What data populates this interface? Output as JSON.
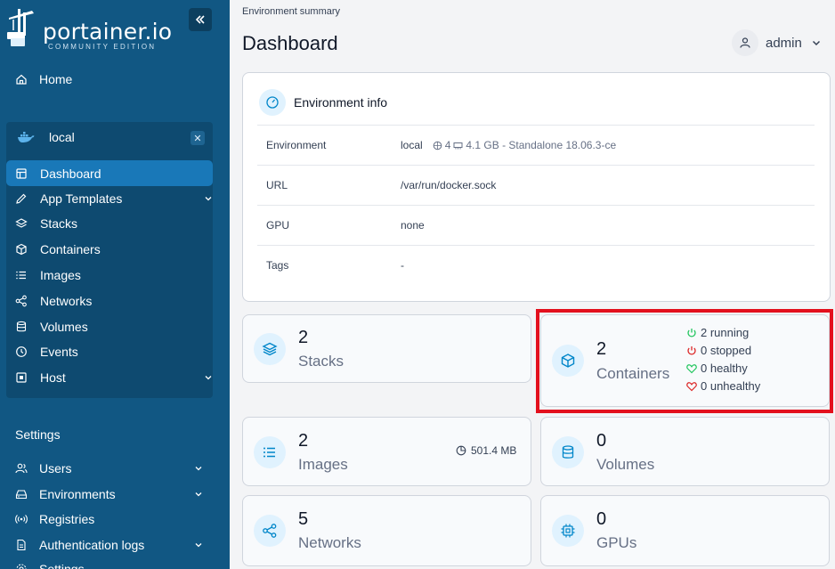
{
  "sidebar": {
    "logo_text": "portainer.io",
    "logo_sub": "COMMUNITY EDITION",
    "home_label": "Home",
    "environment": {
      "name": "local",
      "items": [
        {
          "label": "Dashboard",
          "icon": "dashboard-icon"
        },
        {
          "label": "App Templates",
          "icon": "edit-icon"
        },
        {
          "label": "Stacks",
          "icon": "layers-icon"
        },
        {
          "label": "Containers",
          "icon": "box-icon"
        },
        {
          "label": "Images",
          "icon": "list-icon"
        },
        {
          "label": "Networks",
          "icon": "share-icon"
        },
        {
          "label": "Volumes",
          "icon": "database-icon"
        },
        {
          "label": "Events",
          "icon": "clock-icon"
        },
        {
          "label": "Host",
          "icon": "cpu-icon"
        }
      ]
    },
    "settings_title": "Settings",
    "settings_items": [
      {
        "label": "Users"
      },
      {
        "label": "Environments"
      },
      {
        "label": "Registries"
      },
      {
        "label": "Authentication logs"
      },
      {
        "label": "Settings"
      }
    ]
  },
  "header": {
    "breadcrumb": "Environment summary",
    "title": "Dashboard",
    "user": "admin"
  },
  "env_info": {
    "title": "Environment info",
    "rows": [
      {
        "key": "Environment",
        "value": "local",
        "cpu": "4",
        "mem": "4.1 GB - Standalone 18.06.3-ce"
      },
      {
        "key": "URL",
        "value": "/var/run/docker.sock"
      },
      {
        "key": "GPU",
        "value": "none"
      },
      {
        "key": "Tags",
        "value": "-"
      }
    ]
  },
  "stats": {
    "stacks": {
      "count": "2",
      "label": "Stacks"
    },
    "containers": {
      "count": "2",
      "label": "Containers",
      "running": "2 running",
      "stopped": "0 stopped",
      "healthy": "0 healthy",
      "unhealthy": "0 unhealthy"
    },
    "images": {
      "count": "2",
      "label": "Images",
      "size": "501.4 MB"
    },
    "volumes": {
      "count": "0",
      "label": "Volumes"
    },
    "networks": {
      "count": "5",
      "label": "Networks"
    },
    "gpus": {
      "count": "0",
      "label": "GPUs"
    }
  },
  "colors": {
    "sidebar": "#115783",
    "active": "#1978b8",
    "accent": "#0086c9",
    "highlight": "#e3101d",
    "running": "#22c55e",
    "stopped": "#dc2626"
  }
}
